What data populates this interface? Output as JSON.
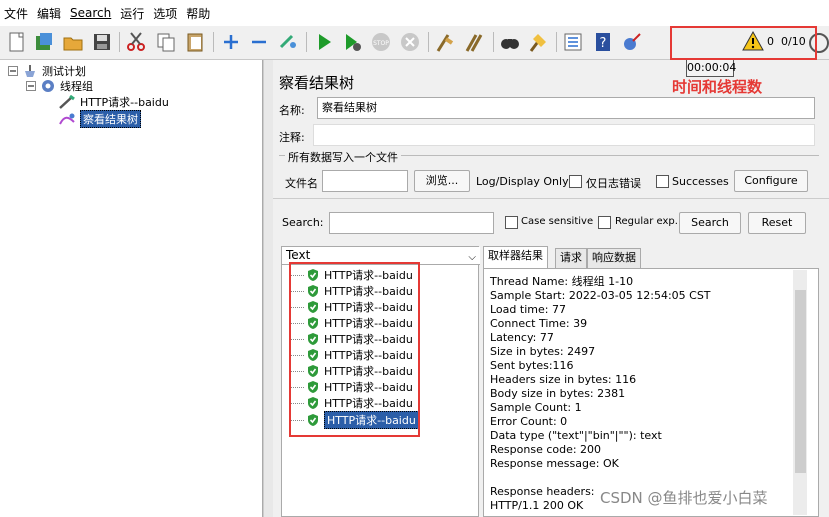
{
  "menu": [
    "文件",
    "编辑",
    "Search",
    "运行",
    "选项",
    "帮助"
  ],
  "toolbar": {
    "timer": "00:00:04",
    "warnings": "0",
    "threads": "0/10"
  },
  "annotation": "时间和线程数",
  "tree": {
    "plan": "测试计划",
    "group": "线程组",
    "request": "HTTP请求--baidu",
    "listener": "察看结果树"
  },
  "panel": {
    "title": "察看结果树",
    "name_label": "名称:",
    "name_value": "察看结果树",
    "comment_label": "注释:",
    "group_title": "所有数据写入一个文件",
    "file_label": "文件名",
    "browse_label": "浏览...",
    "log_label": "Log/Display Only:",
    "errors_label": "仅日志错误",
    "successes_label": "Successes",
    "configure_label": "Configure",
    "search_label": "Search:",
    "case_label": "Case sensitive",
    "regex_label": "Regular exp.",
    "search_button": "Search",
    "reset_button": "Reset"
  },
  "results": {
    "renderer": "Text",
    "items": [
      "HTTP请求--baidu",
      "HTTP请求--baidu",
      "HTTP请求--baidu",
      "HTTP请求--baidu",
      "HTTP请求--baidu",
      "HTTP请求--baidu",
      "HTTP请求--baidu",
      "HTTP请求--baidu",
      "HTTP请求--baidu",
      "HTTP请求--baidu"
    ]
  },
  "tabs": [
    "取样器结果",
    "请求",
    "响应数据"
  ],
  "detail": [
    "Thread Name: 线程组 1-10",
    "Sample Start: 2022-03-05 12:54:05 CST",
    "Load time: 77",
    "Connect Time: 39",
    "Latency: 77",
    "Size in bytes: 2497",
    "Sent bytes:116",
    "Headers size in bytes: 116",
    "Body size in bytes: 2381",
    "Sample Count: 1",
    "Error Count: 0",
    "Data type (\"text\"|\"bin\"|\"\"): text",
    "Response code: 200",
    "Response message: OK",
    "",
    "Response headers:",
    "HTTP/1.1 200 OK"
  ],
  "watermark": "CSDN @鱼排也爱小白菜"
}
